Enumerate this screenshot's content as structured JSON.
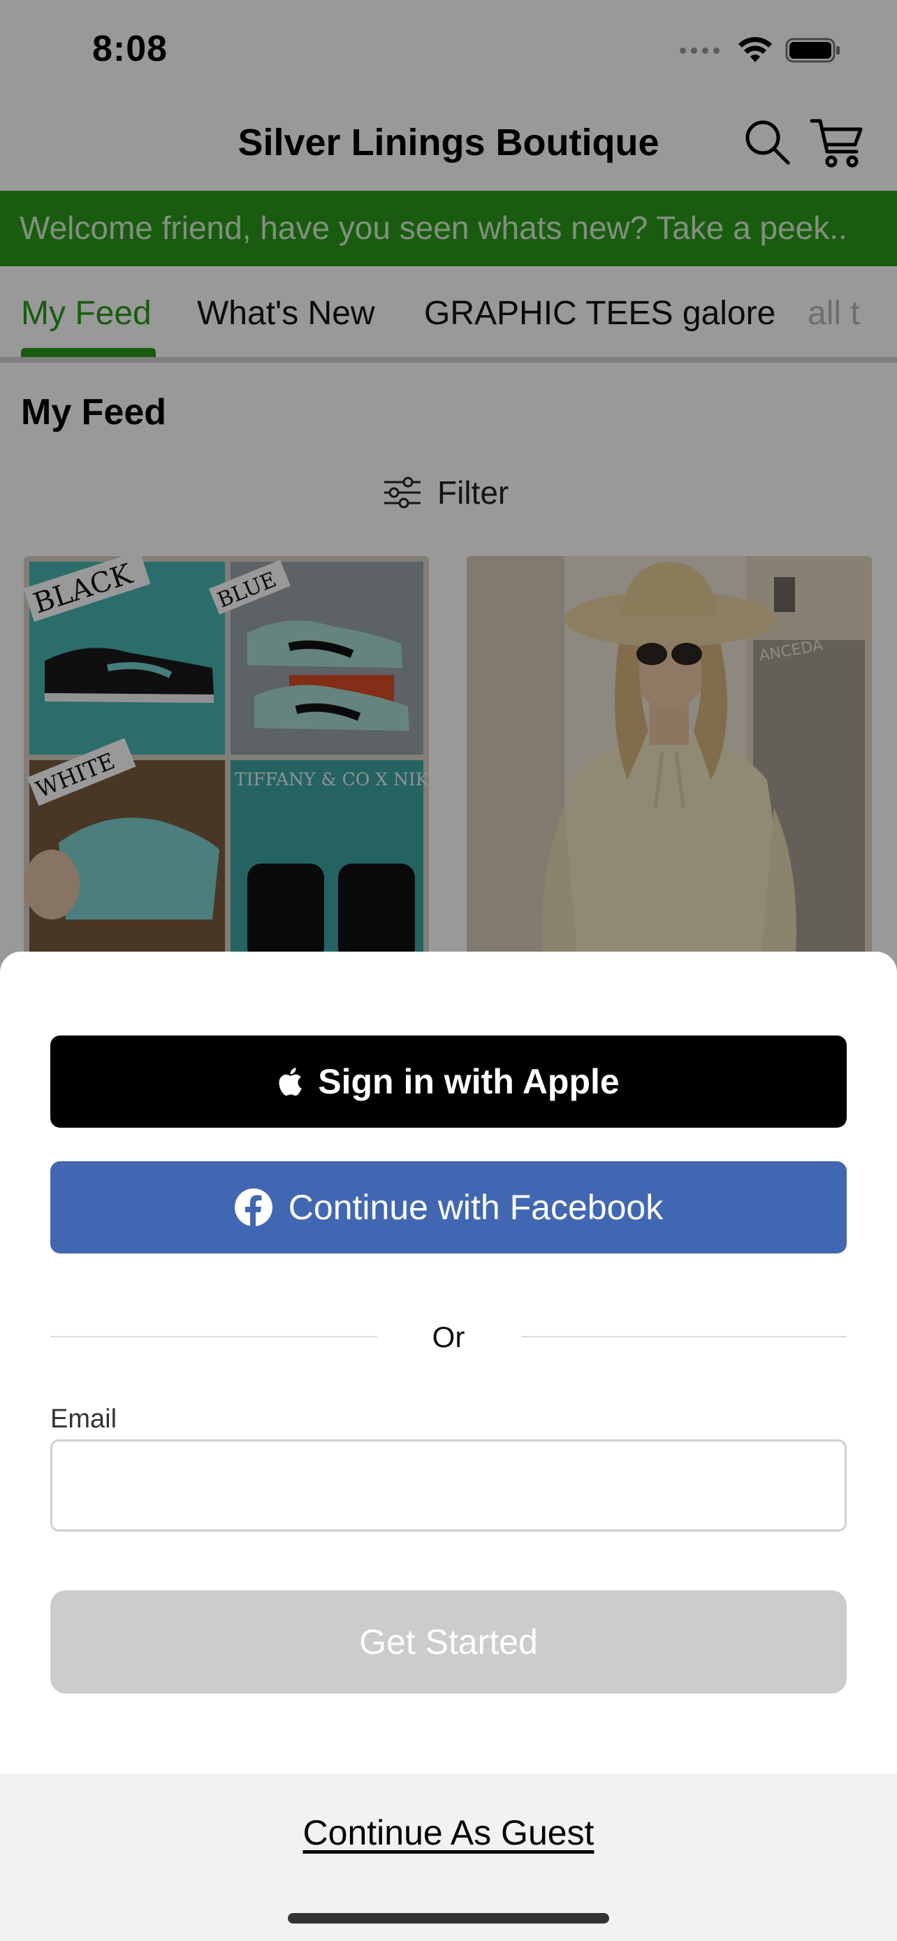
{
  "status_bar": {
    "time": "8:08"
  },
  "header": {
    "title": "Silver Linings Boutique",
    "search_icon": "search-icon",
    "cart_icon": "cart-icon"
  },
  "banner": {
    "text": "Welcome friend, have you seen whats new? Take a peek.."
  },
  "tabs": [
    {
      "label": "My Feed",
      "active": true
    },
    {
      "label": "What's New"
    },
    {
      "label": "GRAPHIC TEES galore"
    },
    {
      "label": "all t"
    }
  ],
  "feed": {
    "title": "My Feed",
    "filter_label": "Filter",
    "card1_labels": [
      "BLACK",
      "BLUE",
      "WHITE",
      "TIFFANY & CO X NIKE"
    ],
    "card2_sign": "ANCEDA"
  },
  "login_sheet": {
    "apple_label": "Sign in with Apple",
    "facebook_label": "Continue with Facebook",
    "divider_text": "Or",
    "email_label": "Email",
    "email_value": "",
    "email_placeholder": "",
    "get_started_label": "Get Started",
    "guest_label": "Continue As Guest"
  },
  "colors": {
    "brand_green": "#2a9a1c",
    "facebook_blue": "#4267b2",
    "apple_black": "#000000",
    "disabled_button": "#cccccc"
  }
}
